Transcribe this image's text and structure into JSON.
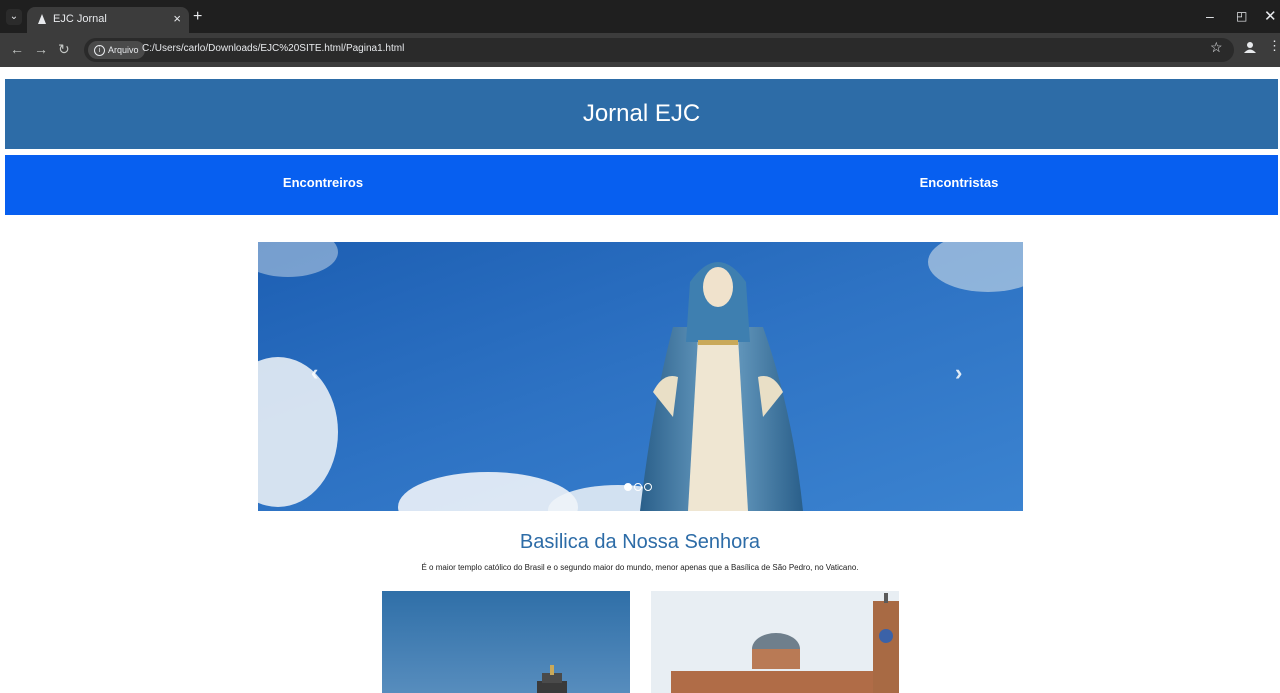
{
  "browser": {
    "tab_title": "EJC Jornal",
    "tab_close": "×",
    "new_tab": "+",
    "chip_label": "Arquivo",
    "url": "C:/Users/carlo/Downloads/EJC%20SITE.html/Pagina1.html"
  },
  "site": {
    "header_title": "Jornal EJC",
    "menu": [
      "Encontreiros",
      "Encontristas"
    ]
  },
  "carousel": {
    "prev": "‹",
    "next": "›",
    "slide_count": 3,
    "active_index": 0
  },
  "feature": {
    "title": "Basilica da Nossa Senhora",
    "description": "É o maior templo católico do Brasil e o segundo maior do mundo, menor apenas que a Basílica de São Pedro, no Vaticano."
  }
}
